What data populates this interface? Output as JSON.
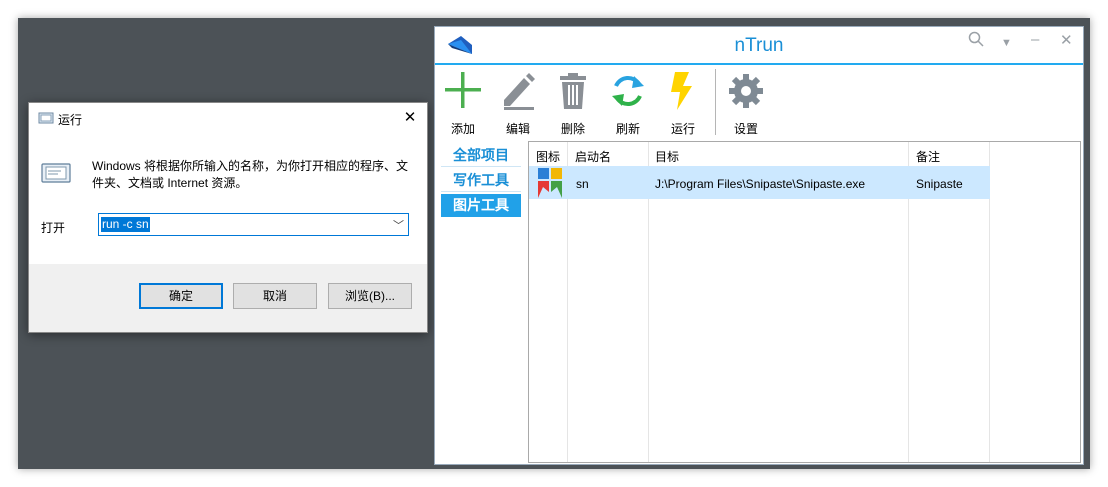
{
  "run_dialog": {
    "title": "运行",
    "description": "Windows 将根据你所输入的名称，为你打开相应的程序、文件夹、文档或 Internet 资源。",
    "open_label": "打开",
    "input_value": "run -c sn",
    "ok_label": "确定",
    "cancel_label": "取消",
    "browse_label": "浏览(B)..."
  },
  "ntrun": {
    "title": "nTrun",
    "toolbar": {
      "add": "添加",
      "edit": "编辑",
      "delete": "删除",
      "refresh": "刷新",
      "run": "运行",
      "settings": "设置"
    },
    "categories": [
      "全部项目",
      "写作工具",
      "图片工具"
    ],
    "selected_category": "图片工具",
    "columns": [
      "图标",
      "启动名",
      "目标",
      "备注"
    ],
    "rows": [
      {
        "name": "sn",
        "target": "J:\\Program Files\\Snipaste\\Snipaste.exe",
        "note": "Snipaste"
      }
    ]
  },
  "colors": {
    "accent": "#1a8fd6",
    "selection": "#cce8ff",
    "desktop": "#4c5257"
  }
}
